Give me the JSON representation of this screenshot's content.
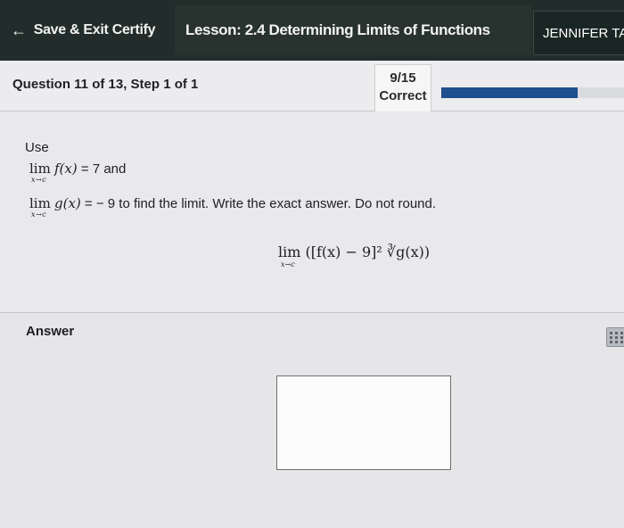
{
  "header": {
    "exit_label": "Save & Exit Certify",
    "lesson_title": "Lesson: 2.4 Determining Limits of Functions",
    "user_name": "JENNIFER TA"
  },
  "question_bar": {
    "title": "Question 11 of 13, Step 1 of 1",
    "score": "9/15",
    "status": "Correct",
    "progress_fraction": 0.73
  },
  "problem": {
    "use_label": "Use",
    "lim_word": "lim",
    "sub": "x→c",
    "line1_fx": "f(x)",
    "line1_rest": " = 7 and",
    "line2_gx": "g(x)",
    "line2_rest": " = − 9 to find the limit. Write the exact answer. Do not round.",
    "expression": "lim ([f(x) − 9]² ∛g(x))",
    "expression_sub": "x→c"
  },
  "answer": {
    "label": "Answer"
  },
  "icons": {
    "back": "arrow-left-icon",
    "keypad": "keypad-icon"
  }
}
